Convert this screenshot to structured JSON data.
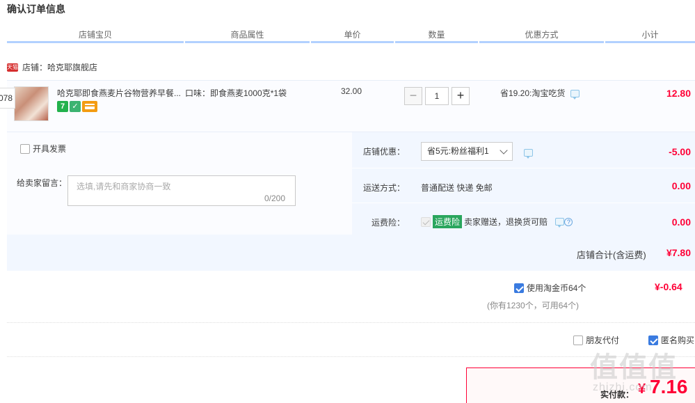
{
  "page": {
    "title": "确认订单信息"
  },
  "columns": [
    "店铺宝贝",
    "商品属性",
    "单价",
    "数量",
    "优惠方式",
    "小计"
  ],
  "store": {
    "badge": "天猫",
    "label": "店铺：哈克耶旗舰店"
  },
  "side_tab": "078",
  "item": {
    "name": "哈克耶即食燕麦片谷物营养早餐...",
    "badges": [
      "7",
      "✓",
      ""
    ],
    "attribute": "口味：即食燕麦1000克*1袋",
    "unit_price": "32.00",
    "quantity": "1",
    "quantity_minus": "−",
    "quantity_plus": "+",
    "discount": "省19.20:淘宝吃货",
    "subtotal": "12.80"
  },
  "invoice": {
    "label": "开具发票",
    "checked": false
  },
  "message": {
    "label": "给卖家留言：",
    "placeholder": "选填,请先和商家协商一致",
    "counter": "0/200"
  },
  "store_promo": {
    "label": "店铺优惠：",
    "selected": "省5元:粉丝福利1",
    "amount": "-5.00"
  },
  "shipping": {
    "label": "运送方式：",
    "value": "普通配送 快递 免邮",
    "amount": "0.00"
  },
  "insurance": {
    "label": "运费险：",
    "badge": "运费险",
    "text": "卖家赠送，退换货可赔",
    "help": "?",
    "amount": "0.00"
  },
  "store_total": {
    "label": "店铺合计(含运费)",
    "amount": "¥7.80"
  },
  "coins": {
    "label": "使用淘金币64个",
    "checked": true,
    "amount": "¥-0.64",
    "sub": "(你有1230个，可用64个)"
  },
  "options": {
    "friend_pay": {
      "label": "朋友代付",
      "checked": false
    },
    "anonymous": {
      "label": "匿名购买",
      "checked": true
    }
  },
  "payment": {
    "label": "实付款：",
    "currency": "¥",
    "amount": "7.16"
  },
  "watermark": {
    "text": "值值值",
    "sub": "zhizhi.com"
  },
  "colors": {
    "accent_red": "#ff0036",
    "header_underline": "#b2d1ff",
    "checkbox_blue": "#3a7be0",
    "insurance_green": "#2aa65d"
  }
}
